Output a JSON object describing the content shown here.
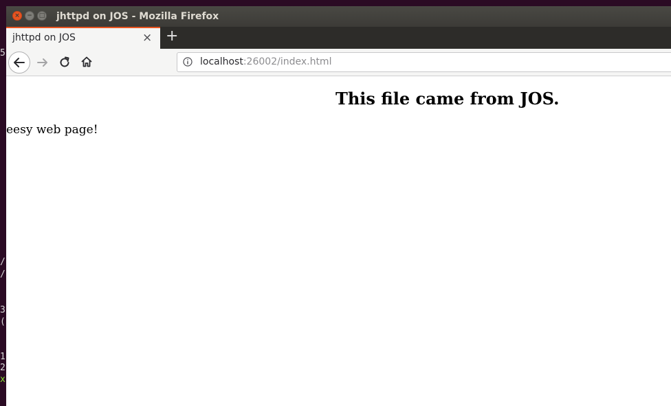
{
  "window": {
    "title": "jhttpd on JOS - Mozilla Firefox",
    "close_label": "×",
    "min_label": "−",
    "max_label": "□"
  },
  "tabs": [
    {
      "label": "jhttpd on JOS",
      "close_label": "×"
    }
  ],
  "newtab_label": "+",
  "address": {
    "host": "localhost",
    "rest": ":26002/index.html"
  },
  "page": {
    "heading": "This file came from JOS.",
    "paragraph": "eesy web page!"
  },
  "terminal_fragments": [
    "5",
    "/f",
    "/h",
    "3",
    "(",
    "1",
    "2",
    "x"
  ],
  "icons": {
    "back": "back-arrow-icon",
    "forward": "forward-arrow-icon",
    "reload": "reload-icon",
    "home": "home-icon",
    "info": "info-icon"
  },
  "colors": {
    "accent": "#e95420",
    "titlebar": "#3c3b37"
  }
}
